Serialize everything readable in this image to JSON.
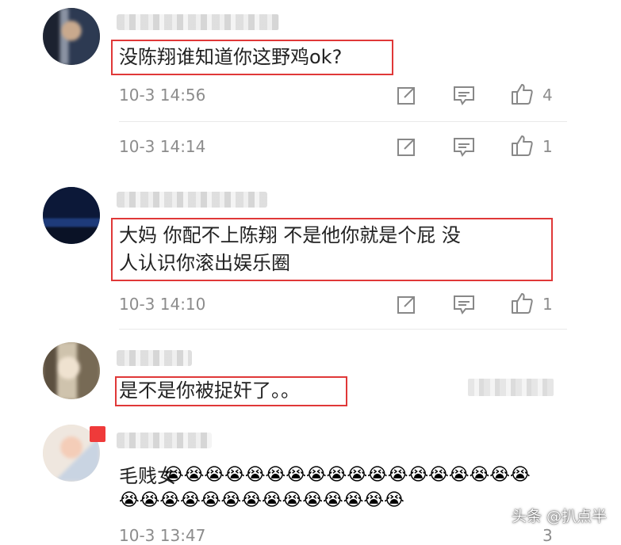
{
  "comments": [
    {
      "text": "没陈翔谁知道你这野鸡ok?",
      "time": "10-3 14:56",
      "likes": "4"
    },
    {
      "text": "",
      "time": "10-3 14:14",
      "likes": "1"
    },
    {
      "text_line1": "大妈  你配不上陈翔  不是他你就是个屁  没",
      "text_line2": "人认识你滚出娱乐圈",
      "time": "10-3 14:10",
      "likes": "1"
    },
    {
      "text": "是不是你被捉奸了。。",
      "time": "",
      "likes": ""
    },
    {
      "text": "毛贱女",
      "emoji_row1": "😭😭😭😭😭😭😭😭😭😭😭😭😭😭😭😭😭😭",
      "emoji_row2": "😭😭😭😭😭😭😭😭😭😭😭😭😭😭",
      "time": "10-3 13:47",
      "likes": "3"
    }
  ],
  "watermark": "头条 @扒点半",
  "colors": {
    "highlight": "#e03838",
    "meta_text": "#8c8c8c",
    "body_text": "#222222"
  },
  "icons": [
    "share-icon",
    "comment-icon",
    "thumbs-up-icon"
  ]
}
